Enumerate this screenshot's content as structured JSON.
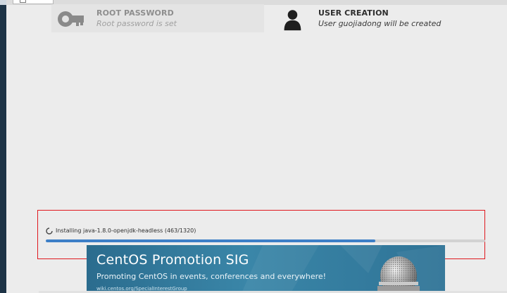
{
  "window": {
    "accent": "#1d3346"
  },
  "spokes": {
    "root_password": {
      "title": "ROOT PASSWORD",
      "status": "Root password is set",
      "icon": "key-icon"
    },
    "user_creation": {
      "title": "USER CREATION",
      "status": "User guojiadong will be created",
      "icon": "user-icon"
    }
  },
  "progress": {
    "label": "Installing java-1.8.0-openjdk-headless (463/1320)",
    "current": 463,
    "total": 1320,
    "bar_fraction": 0.75,
    "bar_color": "#3d7fc7",
    "icon": "spinner-icon"
  },
  "banner": {
    "title": "CentOS Promotion SIG",
    "subtitle": "Promoting CentOS in events, conferences and everywhere!",
    "url": "wiki.centos.org/SpecialInterestGroup",
    "icon": "microphone-icon"
  },
  "annotation": {
    "highlight_color": "#e0181e"
  }
}
